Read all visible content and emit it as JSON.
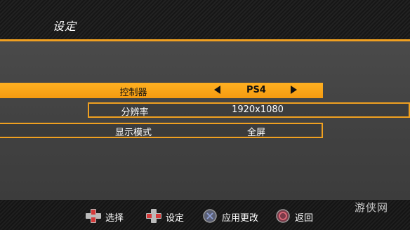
{
  "header": {
    "title": "设定"
  },
  "settings": {
    "controller": {
      "label": "控制器",
      "value": "PS4"
    },
    "resolution": {
      "label": "分辨率",
      "value": "1920x1080"
    },
    "display_mode": {
      "label": "显示模式",
      "value": "全屏"
    }
  },
  "footer": {
    "hints": [
      {
        "icon": "dpad-up-down-icon",
        "label": "选择"
      },
      {
        "icon": "dpad-left-right-icon",
        "label": "设定"
      },
      {
        "icon": "cross-button-icon",
        "label": "应用更改"
      },
      {
        "icon": "circle-button-icon",
        "label": "返回"
      }
    ]
  },
  "watermark": "游侠网",
  "colors": {
    "accent": "#f0a020",
    "highlight_row": "#ffb021",
    "panel": "#454545"
  }
}
